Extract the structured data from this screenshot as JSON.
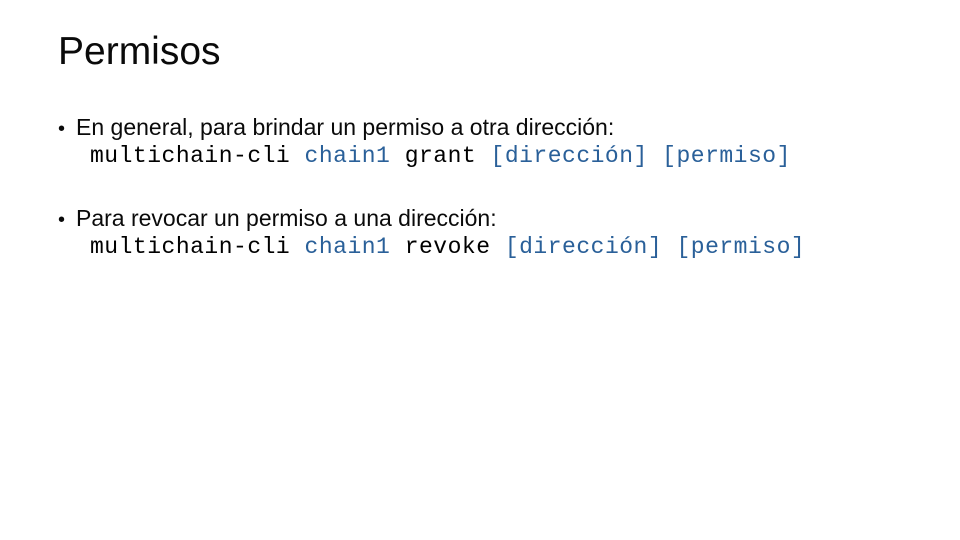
{
  "title": "Permisos",
  "items": [
    {
      "text": "En general, para brindar un permiso a otra dirección:",
      "code": [
        {
          "t": "multichain-cli",
          "c": "black"
        },
        {
          "t": " ",
          "c": "black"
        },
        {
          "t": "chain1",
          "c": "blue"
        },
        {
          "t": " ",
          "c": "black"
        },
        {
          "t": "grant",
          "c": "black"
        },
        {
          "t": " ",
          "c": "black"
        },
        {
          "t": "[dirección]",
          "c": "blue"
        },
        {
          "t": " ",
          "c": "black"
        },
        {
          "t": "[permiso]",
          "c": "blue"
        }
      ]
    },
    {
      "text": "Para revocar un permiso a una dirección:",
      "code": [
        {
          "t": "multichain-cli",
          "c": "black"
        },
        {
          "t": " ",
          "c": "black"
        },
        {
          "t": "chain1",
          "c": "blue"
        },
        {
          "t": " ",
          "c": "black"
        },
        {
          "t": "revoke",
          "c": "black"
        },
        {
          "t": " ",
          "c": "black"
        },
        {
          "t": "[dirección]",
          "c": "blue"
        },
        {
          "t": " ",
          "c": "black"
        },
        {
          "t": "[permiso]",
          "c": "blue"
        }
      ]
    }
  ]
}
